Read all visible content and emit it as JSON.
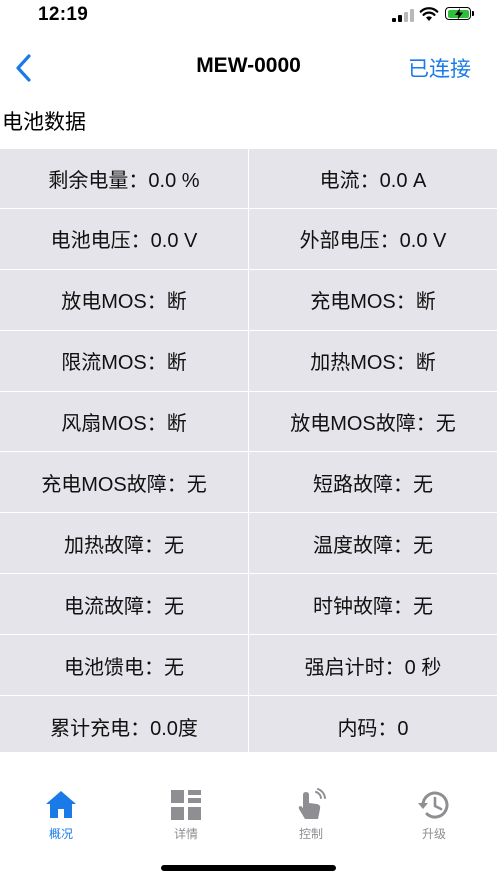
{
  "status_bar": {
    "time": "12:19"
  },
  "nav": {
    "title": "MEW-0000",
    "status": "已连接"
  },
  "section_title": "电池数据",
  "data_grid": [
    [
      "剩余电量：0.0 %",
      "电流：0.0 A"
    ],
    [
      "电池电压：0.0 V",
      "外部电压：0.0 V"
    ],
    [
      "放电MOS：断",
      "充电MOS：断"
    ],
    [
      "限流MOS：断",
      "加热MOS：断"
    ],
    [
      "风扇MOS：断",
      "放电MOS故障：无"
    ],
    [
      "充电MOS故障：无",
      "短路故障：无"
    ],
    [
      "加热故障：无",
      "温度故障：无"
    ],
    [
      "电流故障：无",
      "时钟故障：无"
    ],
    [
      "电池馈电：无",
      "强启计时：0 秒"
    ],
    [
      "累计充电：0.0度",
      "内码：0"
    ]
  ],
  "tabs": [
    {
      "label": "概况",
      "icon": "home-icon",
      "active": true
    },
    {
      "label": "详情",
      "icon": "grid-icon",
      "active": false
    },
    {
      "label": "控制",
      "icon": "touch-icon",
      "active": false
    },
    {
      "label": "升级",
      "icon": "history-icon",
      "active": false
    }
  ],
  "colors": {
    "accent": "#1a7be8",
    "grid_background": "#e4e4ea",
    "tab_inactive": "#8e8e93",
    "battery": "#2fbf3b"
  }
}
